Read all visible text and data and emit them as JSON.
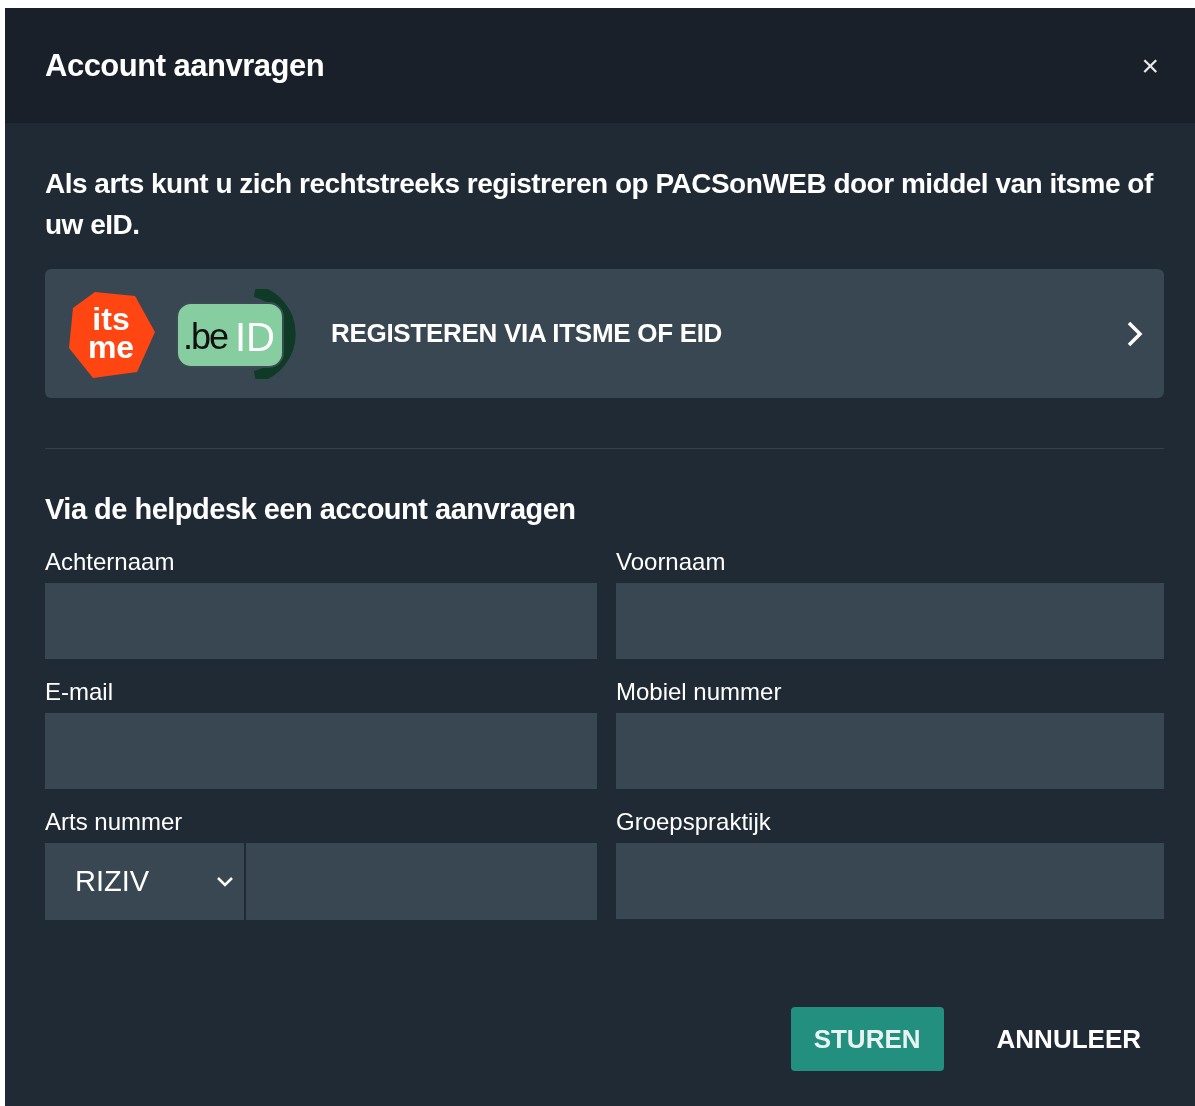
{
  "dialog": {
    "title": "Account aanvragen",
    "close": "×"
  },
  "intro": "Als arts kunt u zich rechtstreeks registreren op PACSonWEB door middel van itsme of uw eID.",
  "register_card": {
    "itsme_logo": [
      "its",
      "me"
    ],
    "beid_logo": [
      ".be",
      "ID"
    ],
    "label": "REGISTEREN VIA ITSME OF EID"
  },
  "helpdesk": {
    "title": "Via de helpdesk een account aanvragen",
    "fields": [
      {
        "kind": "text",
        "label": "Achternaam"
      },
      {
        "kind": "text",
        "label": "Voornaam"
      },
      {
        "kind": "text",
        "label": "E-mail"
      },
      {
        "kind": "text",
        "label": "Mobiel nummer"
      },
      {
        "kind": "select",
        "label": "Arts nummer",
        "select_value": "RIZIV"
      },
      {
        "kind": "text",
        "label": "Groepspraktijk"
      }
    ]
  },
  "buttons": [
    {
      "kind": "primary",
      "label": "STUREN"
    },
    {
      "kind": "text",
      "label": "ANNULEER"
    }
  ]
}
